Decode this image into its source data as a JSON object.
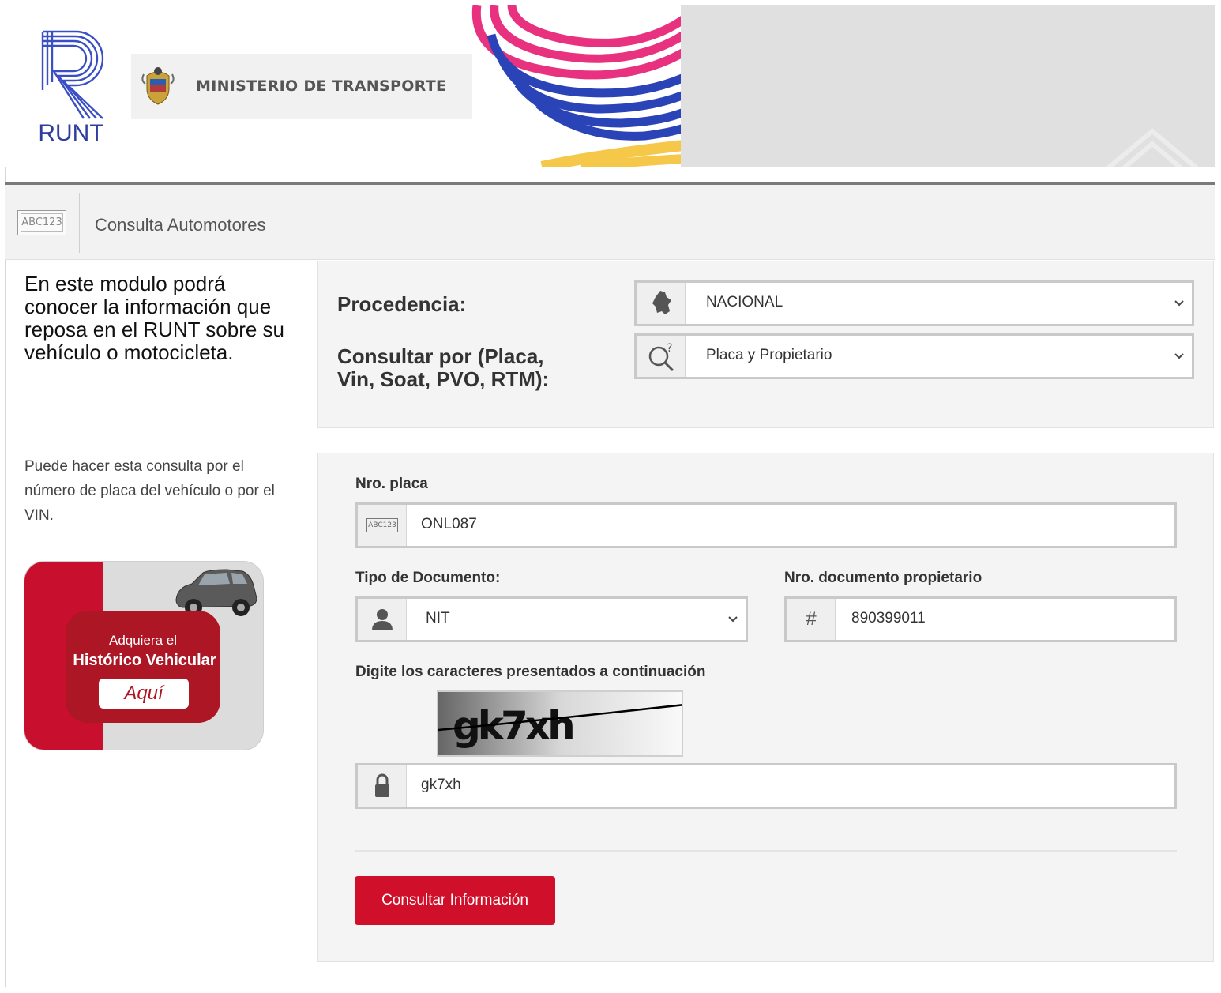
{
  "header": {
    "logo_text": "RUNT",
    "ministry": "MINISTERIO DE TRANSPORTE"
  },
  "section": {
    "icon_text": "ABC123",
    "title": "Consulta Automotores"
  },
  "left": {
    "intro": "En este modulo podrá conocer la información que reposa en el RUNT sobre su vehículo o motocicleta.",
    "hint": "Puede hacer esta consulta por el número de placa del vehículo o por el VIN.",
    "promo": {
      "small": "Adquiera el",
      "big": "Histórico Vehicular",
      "button": "Aquí"
    }
  },
  "form_top": {
    "procedencia_label": "Procedencia:",
    "procedencia_value": "NACIONAL",
    "consultar_label_1": "Consultar por (Placa,",
    "consultar_label_2": "Vin, Soat, PVO, RTM):",
    "consultar_value": "Placa y Propietario"
  },
  "form": {
    "placa_label": "Nro. placa",
    "placa_icon_text": "ABC123",
    "placa_value": "ONL087",
    "tipo_doc_label": "Tipo de Documento:",
    "tipo_doc_value": "NIT",
    "nro_doc_label": "Nro. documento propietario",
    "nro_doc_icon": "#",
    "nro_doc_value": "890399011",
    "captcha_label": "Digite los caracteres presentados a continuación",
    "captcha_image_text": "gk7xh",
    "captcha_value": "gk7xh",
    "submit": "Consultar Información"
  },
  "colors": {
    "accent": "#d0102b",
    "runt_blue": "#2f3e9e",
    "wave_pink": "#e8317f",
    "wave_blue": "#2a44b8",
    "wave_yellow": "#f5c84a"
  },
  "icons": [
    "runt-logo",
    "colombia-shield-icon",
    "colombia-map-icon",
    "search-question-icon",
    "user-icon",
    "hash-icon",
    "lock-icon",
    "chevron-down-icon"
  ]
}
